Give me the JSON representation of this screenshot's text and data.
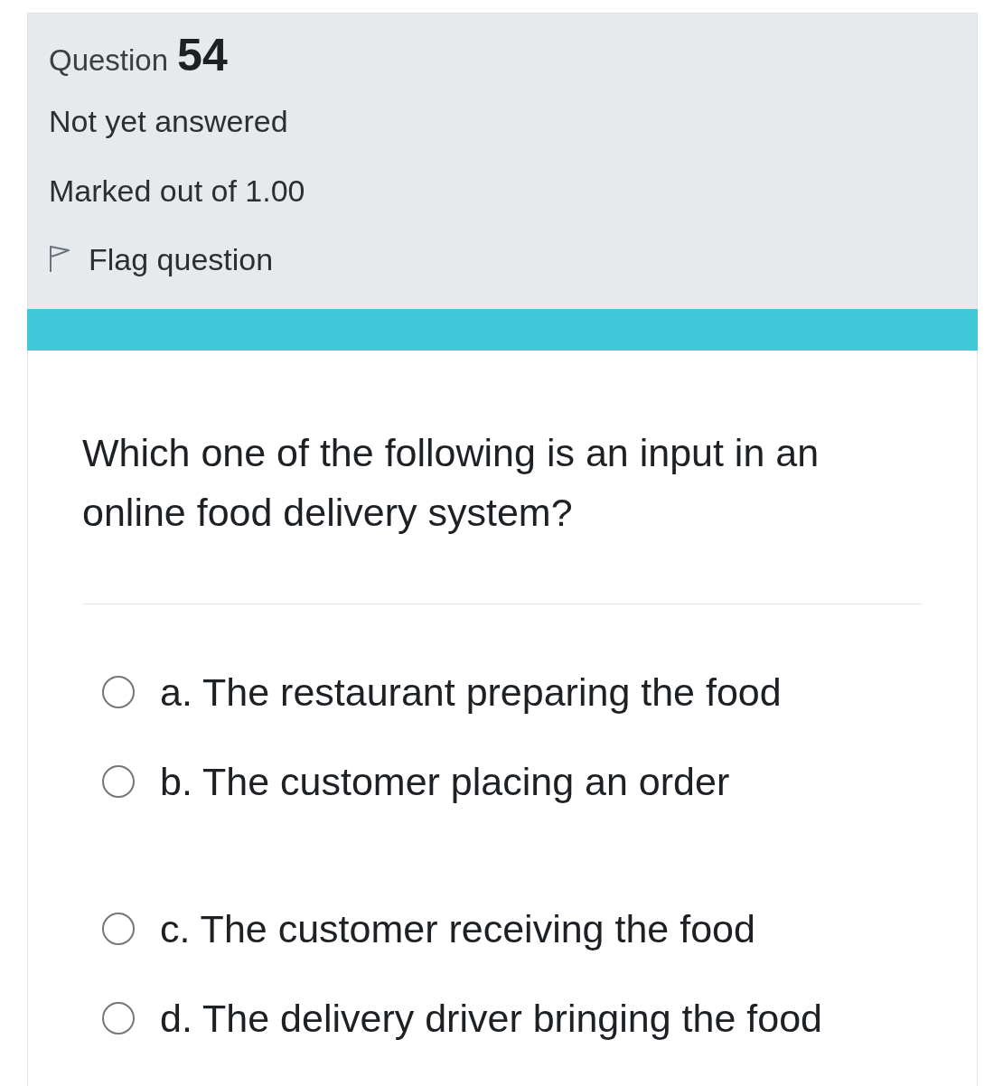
{
  "info": {
    "question_label": "Question",
    "question_number": "54",
    "state": "Not yet answered",
    "mark": "Marked out of 1.00",
    "flag": {
      "label": "Flag question",
      "flagged": false
    }
  },
  "question": {
    "text": "Which one of the following is an input in an online food delivery system?"
  },
  "options": [
    {
      "label": "a. The restaurant preparing the food",
      "selected": false
    },
    {
      "label": "b. The customer placing an order",
      "selected": false
    },
    {
      "label": "c. The customer receiving the food",
      "selected": false
    },
    {
      "label": "d. The delivery driver bringing the food",
      "selected": false
    }
  ]
}
